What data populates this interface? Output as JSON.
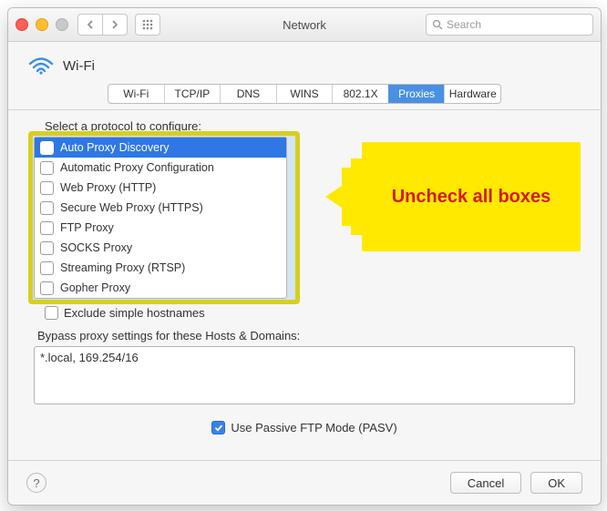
{
  "window": {
    "title": "Network"
  },
  "search": {
    "placeholder": "Search"
  },
  "header": {
    "title": "Wi-Fi"
  },
  "tabs": [
    {
      "label": "Wi-Fi"
    },
    {
      "label": "TCP/IP"
    },
    {
      "label": "DNS"
    },
    {
      "label": "WINS"
    },
    {
      "label": "802.1X"
    },
    {
      "label": "Proxies"
    },
    {
      "label": "Hardware"
    }
  ],
  "active_tab_index": 5,
  "protocol_label": "Select a protocol to configure:",
  "protocols": [
    {
      "label": "Auto Proxy Discovery",
      "checked": false,
      "selected": true
    },
    {
      "label": "Automatic Proxy Configuration",
      "checked": false
    },
    {
      "label": "Web Proxy (HTTP)",
      "checked": false
    },
    {
      "label": "Secure Web Proxy (HTTPS)",
      "checked": false
    },
    {
      "label": "FTP Proxy",
      "checked": false
    },
    {
      "label": "SOCKS Proxy",
      "checked": false
    },
    {
      "label": "Streaming Proxy (RTSP)",
      "checked": false
    },
    {
      "label": "Gopher Proxy",
      "checked": false
    }
  ],
  "annotation": {
    "text": "Uncheck all boxes"
  },
  "exclude_simple_label": "Exclude simple hostnames",
  "exclude_simple_checked": false,
  "bypass_label": "Bypass proxy settings for these Hosts & Domains:",
  "bypass_value": "*.local, 169.254/16",
  "passive_ftp_label": "Use Passive FTP Mode (PASV)",
  "passive_ftp_checked": true,
  "buttons": {
    "help": "?",
    "cancel": "Cancel",
    "ok": "OK"
  },
  "colors": {
    "accent": "#4a90e2",
    "annotation_bg": "#ffe900",
    "annotation_text": "#d11b1b",
    "highlight_border": "#d7cf1e"
  }
}
